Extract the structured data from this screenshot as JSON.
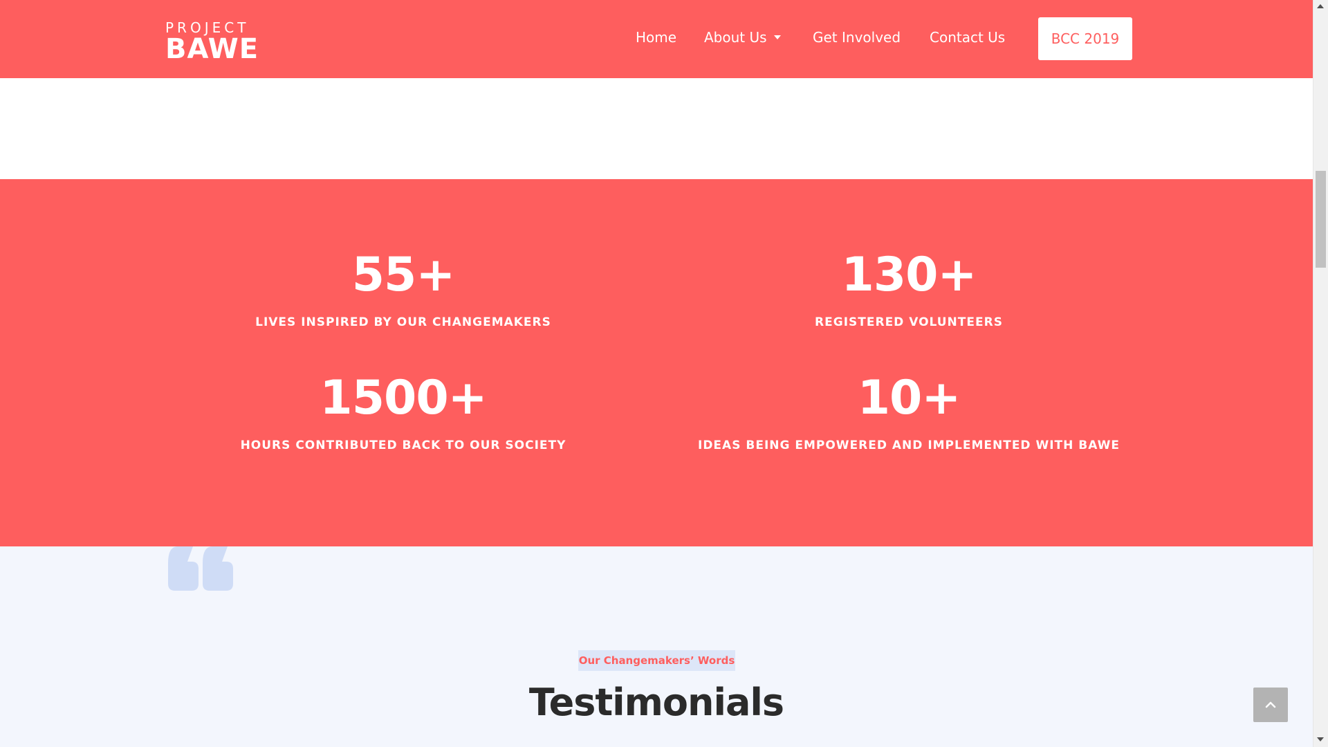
{
  "nav": {
    "logo_top": "PROJECT",
    "logo_bottom": "BAWE",
    "links": [
      {
        "label": "Home"
      },
      {
        "label": "About Us"
      },
      {
        "label": "Get Involved"
      },
      {
        "label": "Contact Us"
      }
    ],
    "cta_label": "BCC 2019"
  },
  "stats": [
    {
      "value": "55+",
      "label": "LIVES INSPIRED BY OUR CHANGEMAKERS"
    },
    {
      "value": "130+",
      "label": "REGISTERED VOLUNTEERS"
    },
    {
      "value": "1500+",
      "label": "HOURS CONTRIBUTED BACK TO OUR SOCIETY"
    },
    {
      "value": "10+",
      "label": "IDEAS BEING EMPOWERED AND IMPLEMENTED WITH BAWE"
    }
  ],
  "testimonials": {
    "tagline": "Our Changemakers’ Words",
    "title": "Testimonials"
  },
  "colors": {
    "brand": "#fe5e5e",
    "section_bg": "#f3f6fd",
    "tag_bg": "#dde6f8",
    "quote_icon": "#cfdcf6",
    "scroll_top_bg": "#b3b3b3"
  },
  "icons": {
    "quote": "quote-icon",
    "scroll_top": "chevron-up-icon",
    "dropdown": "caret-down-icon"
  }
}
